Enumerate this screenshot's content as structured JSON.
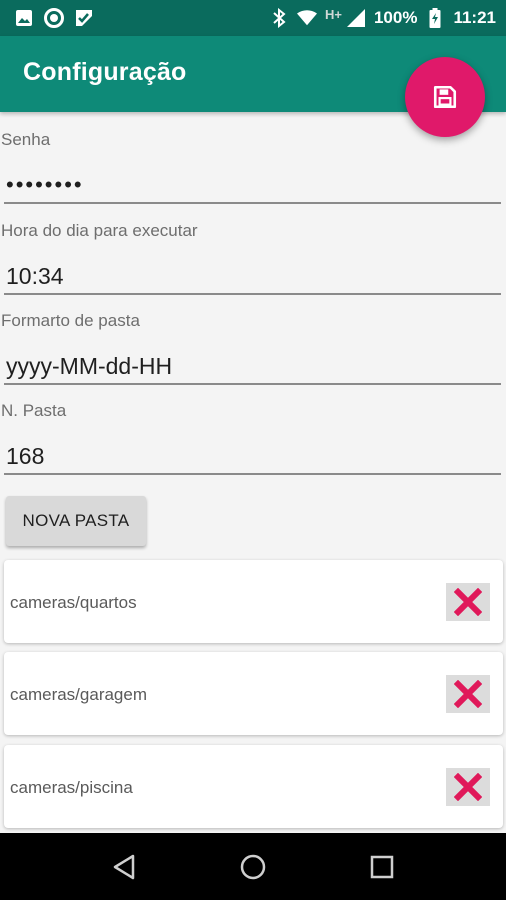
{
  "status_bar": {
    "battery": "100%",
    "time": "11:21",
    "network_type": "H+",
    "icons_left": [
      "image-icon",
      "circle-app-icon",
      "check-app-icon"
    ],
    "icons_right": [
      "bluetooth-icon",
      "wifi-icon",
      "signal-icon",
      "battery-icon"
    ]
  },
  "app_bar": {
    "title": "Configuração",
    "fab_icon": "save-icon"
  },
  "form": {
    "senha": {
      "label": "Senha",
      "value": "••••••••"
    },
    "hora": {
      "label": "Hora do dia para executar",
      "value": "10:34"
    },
    "formato": {
      "label": "Formarto de pasta",
      "value": "yyyy-MM-dd-HH"
    },
    "n_pasta": {
      "label": "N. Pasta",
      "value": "168"
    }
  },
  "nova_pasta_button": {
    "label": "NOVA PASTA"
  },
  "folders": [
    {
      "path": "cameras/quartos"
    },
    {
      "path": "cameras/garagem"
    },
    {
      "path": "cameras/piscina"
    }
  ],
  "colors": {
    "status_bar": "#0a6b5d",
    "app_bar": "#0e8a78",
    "fab": "#e0196a",
    "delete_icon": "#e0195a"
  },
  "nav_bar": {
    "buttons": [
      "back-icon",
      "home-icon",
      "recents-icon"
    ]
  }
}
